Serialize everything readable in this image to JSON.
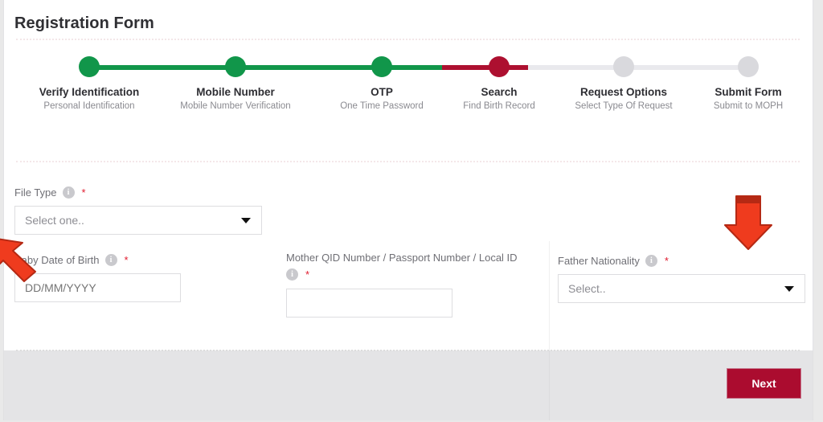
{
  "page": {
    "title": "Registration Form"
  },
  "stepper": {
    "steps": [
      {
        "label": "Verify Identification",
        "sub": "Personal Identification",
        "state": "done"
      },
      {
        "label": "Mobile Number",
        "sub": "Mobile Number Verification",
        "state": "done"
      },
      {
        "label": "OTP",
        "sub": "One Time Password",
        "state": "done"
      },
      {
        "label": "Search",
        "sub": "Find Birth Record",
        "state": "active"
      },
      {
        "label": "Request Options",
        "sub": "Select Type Of Request",
        "state": "todo"
      },
      {
        "label": "Submit Form",
        "sub": "Submit to MOPH",
        "state": "todo"
      }
    ]
  },
  "form": {
    "file_type": {
      "label": "File Type",
      "value": "Select one..",
      "required_marker": "*",
      "info_glyph": "i"
    },
    "baby_dob": {
      "label": "Baby Date of Birth",
      "placeholder": "DD/MM/YYYY",
      "value": "",
      "required_marker": "*",
      "info_glyph": "i"
    },
    "mother_qid": {
      "label": "Mother QID Number / Passport Number / Local ID",
      "placeholder": "",
      "value": "",
      "required_marker": "*",
      "info_glyph": "i"
    },
    "father_nationality": {
      "label": "Father Nationality",
      "value": "Select..",
      "required_marker": "*",
      "info_glyph": "i"
    }
  },
  "footer": {
    "next_label": "Next"
  },
  "colors": {
    "green": "#11964a",
    "crimson": "#ad1030",
    "grey_step": "#d9d9dd",
    "button": "#ab0c2f",
    "required": "#e01b2e",
    "annotation_arrow": "#ef3b1e"
  }
}
